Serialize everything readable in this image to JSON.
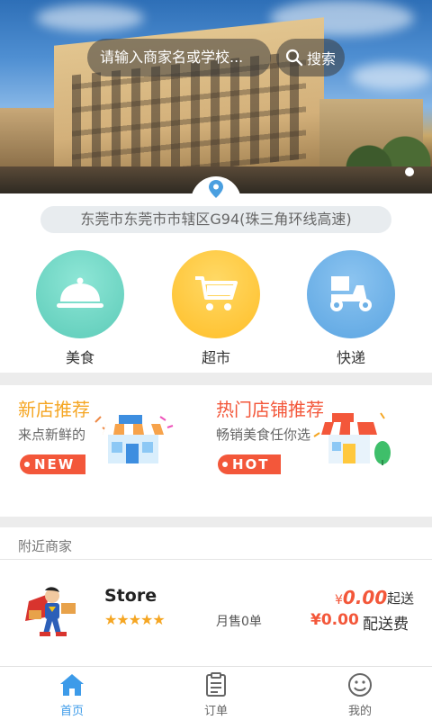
{
  "search": {
    "placeholder": "请输入商家名或学校...",
    "button_label": "搜索"
  },
  "location": {
    "address": "东莞市东莞市市辖区G94(珠三角环线高速)"
  },
  "categories": [
    {
      "label": "美食",
      "icon": "food-cloche-icon",
      "color": "#6cd6c4"
    },
    {
      "label": "超市",
      "icon": "shopping-cart-icon",
      "color": "#ffc83d"
    },
    {
      "label": "快递",
      "icon": "scooter-delivery-icon",
      "color": "#6cb0e6"
    }
  ],
  "promos": [
    {
      "title": "新店推荐",
      "subtitle": "来点新鲜的",
      "tag": "NEW",
      "title_color": "#f5a623"
    },
    {
      "title": "热门店铺推荐",
      "subtitle": "畅销美食任你选",
      "tag": "HOT",
      "title_color": "#f3573a"
    }
  ],
  "nearby": {
    "heading": "附近商家",
    "stores": [
      {
        "name": "Store",
        "rating_stars": "★★★★★",
        "rating": 5,
        "monthly_sales": "月售0单",
        "min_order_symbol": "¥",
        "min_order": "0.00",
        "min_order_label": "起送",
        "delivery_fee": "¥0.00",
        "delivery_fee_label": "配送费"
      }
    ]
  },
  "tabbar": [
    {
      "label": "首页",
      "icon": "home-icon",
      "active": true
    },
    {
      "label": "订单",
      "icon": "orders-icon",
      "active": false
    },
    {
      "label": "我的",
      "icon": "profile-smiley-icon",
      "active": false
    }
  ],
  "colors": {
    "accent": "#f3573a",
    "tab_active": "#3d9be9",
    "tab_inactive": "#666666"
  }
}
